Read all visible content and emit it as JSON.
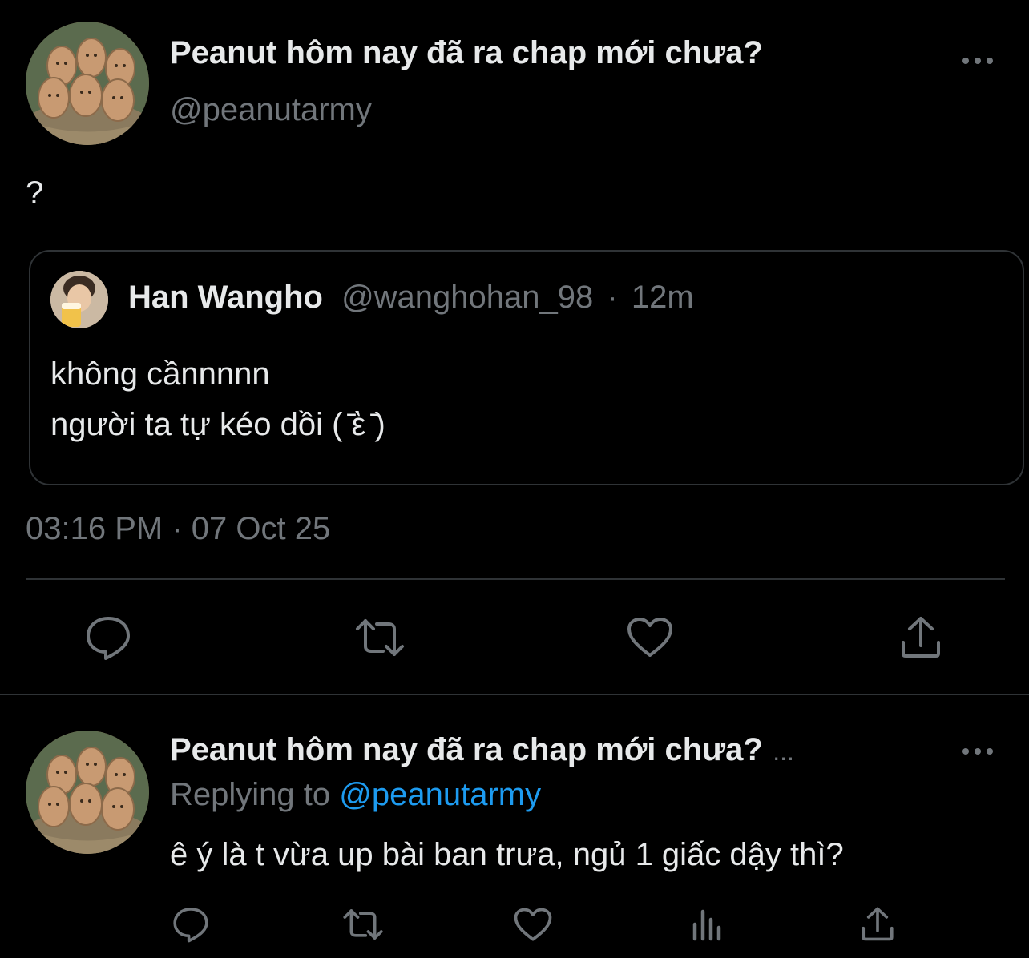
{
  "tweet": {
    "display_name": "Peanut hôm nay đã ra chap mới chưa?",
    "handle": "@peanutarmy",
    "body": "?",
    "more_icon": "more-dots-icon",
    "quote": {
      "display_name": "Han Wangho",
      "handle": "@wanghohan_98",
      "separator": "·",
      "time_ago": "12m",
      "line1": "không cầnnnnn",
      "line2": "người ta tự kéo dồi ( ̄ὲ ̄)"
    },
    "timestamp": "03:16 PM · 07 Oct 25",
    "actions": [
      "reply-icon",
      "retweet-icon",
      "like-icon",
      "share-icon"
    ]
  },
  "reply": {
    "display_name": "Peanut hôm nay đã ra chap mới chưa?",
    "ellipsis": "...",
    "replying_label": "Replying to",
    "replying_handle": "@peanutarmy",
    "body": "ê ý là t vừa up bài ban trưa, ngủ 1 giấc dậy thì?",
    "actions": [
      "reply-icon",
      "retweet-icon",
      "like-icon",
      "views-icon",
      "share-icon"
    ]
  },
  "colors": {
    "background": "#000000",
    "text": "#e7e9ea",
    "muted": "#71767b",
    "link": "#1d9bf0",
    "divider": "#2f3336"
  }
}
